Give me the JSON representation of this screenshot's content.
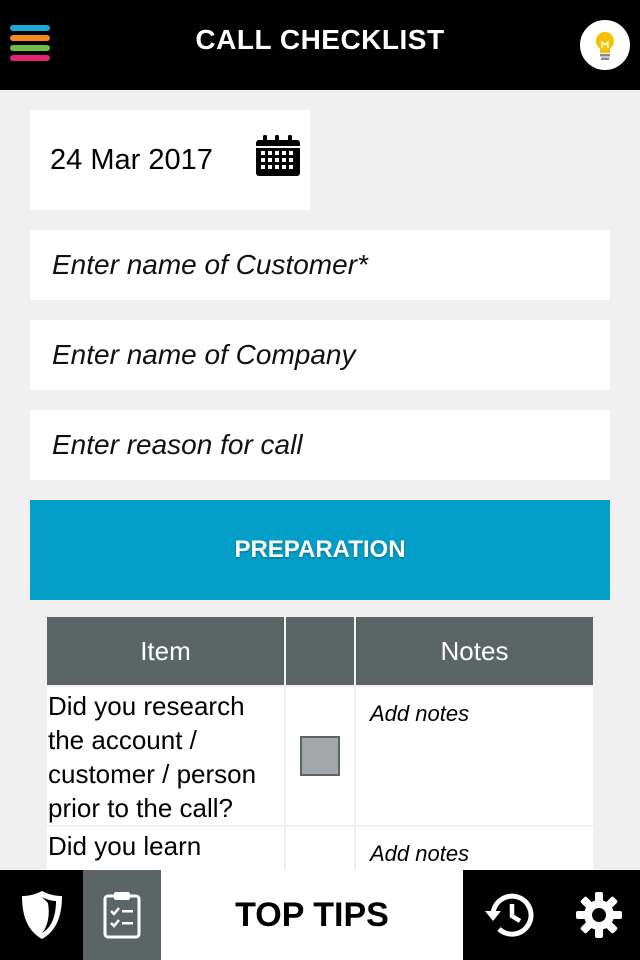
{
  "header": {
    "title": "CALL CHECKLIST",
    "menu_icon": "hamburger-menu-icon",
    "menu_colors": [
      "#1ea9d6",
      "#f28a1c",
      "#6cbe45",
      "#e0246f"
    ],
    "tip_icon": "lightbulb-icon"
  },
  "form": {
    "date": "24 Mar 2017",
    "date_icon": "calendar-icon",
    "customer_placeholder": "Enter name of Customer*",
    "company_placeholder": "Enter name of Company",
    "reason_placeholder": "Enter reason for call"
  },
  "section": {
    "title": "PREPARATION",
    "color": "#049fc8"
  },
  "table": {
    "headers": [
      "Item",
      "",
      "Notes"
    ],
    "rows": [
      {
        "item": "Did you research the account / customer / person prior to the call?",
        "checked": false,
        "notes": "Add notes"
      },
      {
        "item": "Did you learn something about",
        "checked": false,
        "notes": "Add notes"
      }
    ]
  },
  "bottom_nav": {
    "shield_icon": "shield-icon",
    "checklist_icon": "clipboard-checklist-icon",
    "top_tips_label": "TOP TIPS",
    "history_icon": "history-icon",
    "settings_icon": "gear-icon"
  }
}
